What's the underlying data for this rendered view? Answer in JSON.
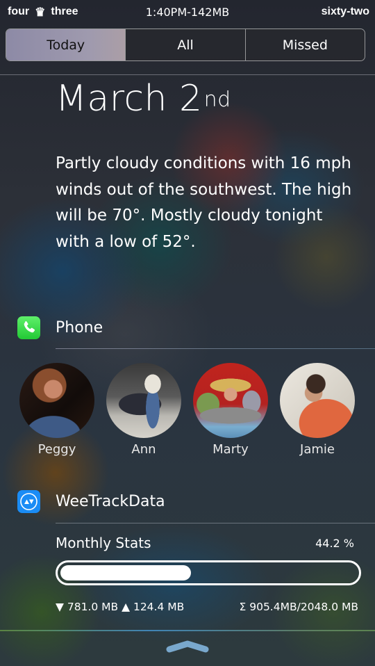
{
  "status_bar": {
    "carrier_left": "four",
    "carrier_icon": "crown-icon",
    "carrier_right": "three",
    "center": "1:40PM-142MB",
    "right": "sixty-two"
  },
  "tabs": [
    {
      "label": "Today",
      "active": true
    },
    {
      "label": "All",
      "active": false
    },
    {
      "label": "Missed",
      "active": false
    }
  ],
  "today": {
    "date_main": "March 2",
    "date_suffix": "nd",
    "forecast": "Partly cloudy conditions with 16 mph winds out of the southwest. The high will be 70°. Mostly cloudy tonight with a low of 52°."
  },
  "phone_widget": {
    "title": "Phone",
    "icon": "phone-icon",
    "icon_color": "#34d84a",
    "contacts": [
      {
        "name": "Peggy"
      },
      {
        "name": "Ann"
      },
      {
        "name": "Marty"
      },
      {
        "name": "Jamie"
      }
    ]
  },
  "weetrack_widget": {
    "title": "WeeTrackData",
    "icon": "up-down-arrows-icon",
    "icon_color": "#1a8cf5",
    "stats_label": "Monthly Stats",
    "percent_label": "44.2 %",
    "progress_fraction": 0.442,
    "download": "781.0 MB",
    "upload": "124.4 MB",
    "total": "Σ 905.4MB/2048.0 MB"
  },
  "bottom": {
    "grabber_icon": "chevron-up-icon"
  }
}
